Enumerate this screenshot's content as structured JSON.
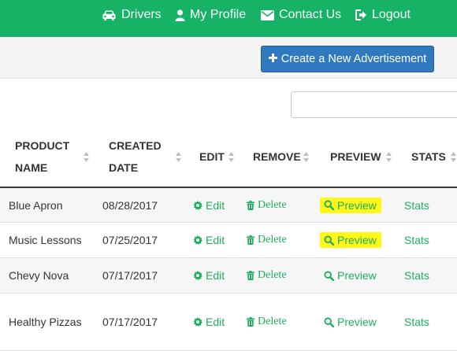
{
  "nav": {
    "drivers": "Drivers",
    "my_profile": "My Profile",
    "contact_us": "Contact Us",
    "logout": "Logout"
  },
  "toolbar": {
    "create_label": "Create a New Advertisement"
  },
  "search": {
    "value": "",
    "placeholder": ""
  },
  "table": {
    "headers": {
      "product_name_1": "PRODUCT",
      "product_name_2": "NAME",
      "created_date_1": "CREATED",
      "created_date_2": "DATE",
      "edit": "EDIT",
      "remove": "REMOVE",
      "preview": "PREVIEW",
      "stats": "STATS"
    },
    "actions": {
      "edit": "Edit",
      "delete": "Delete",
      "preview": "Preview",
      "stats": "Stats"
    },
    "rows": [
      {
        "name": "Blue Apron",
        "date": "08/28/2017",
        "preview_highlighted": true
      },
      {
        "name": "Music Lessons",
        "date": "07/25/2017",
        "preview_highlighted": true
      },
      {
        "name": "Chevy Nova",
        "date": "07/17/2017",
        "preview_highlighted": false
      },
      {
        "name": "Healthy Pizzas",
        "date": "07/17/2017",
        "preview_highlighted": false
      }
    ]
  },
  "colors": {
    "brand_green": "#16b265",
    "action_green": "#1fae5e",
    "button_blue": "#3079bf",
    "highlight_yellow": "#fff71a"
  },
  "icons": [
    "car-icon",
    "user-icon",
    "envelope-icon",
    "logout-icon",
    "plus-icon",
    "sort-icon",
    "cog-icon",
    "trash-icon",
    "search-icon"
  ]
}
